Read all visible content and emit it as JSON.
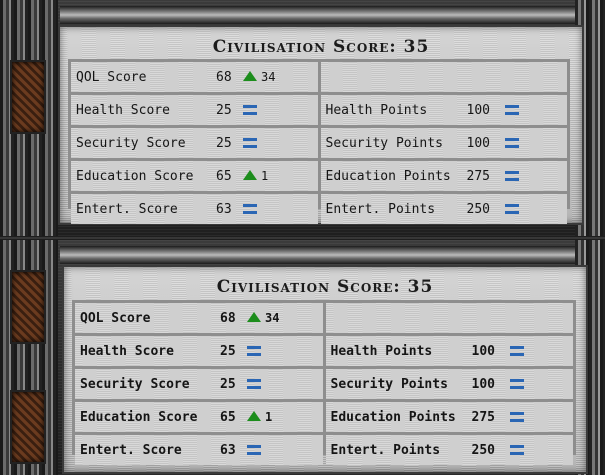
{
  "panels": [
    {
      "title": "Civilisation Score: 35",
      "rows": [
        {
          "left": {
            "label": "QOL Score",
            "value": "68",
            "indicator": "up-arrow-icon",
            "change": "34"
          },
          "right": null
        },
        {
          "left": {
            "label": "Health Score",
            "value": "25",
            "indicator": "equals-icon",
            "change": ""
          },
          "right": {
            "label": "Health Points",
            "value": "100",
            "indicator": "equals-icon"
          }
        },
        {
          "left": {
            "label": "Security Score",
            "value": "25",
            "indicator": "equals-icon",
            "change": ""
          },
          "right": {
            "label": "Security Points",
            "value": "100",
            "indicator": "equals-icon"
          }
        },
        {
          "left": {
            "label": "Education Score",
            "value": "65",
            "indicator": "up-arrow-icon",
            "change": "1"
          },
          "right": {
            "label": "Education Points",
            "value": "275",
            "indicator": "equals-icon"
          }
        },
        {
          "left": {
            "label": "Entert. Score",
            "value": "63",
            "indicator": "equals-icon",
            "change": ""
          },
          "right": {
            "label": "Entert. Points",
            "value": "250",
            "indicator": "equals-icon"
          }
        }
      ]
    },
    {
      "title": "Civilisation Score: 35",
      "rows": [
        {
          "left": {
            "label": "QOL Score",
            "value": "68",
            "indicator": "up-arrow-icon",
            "change": "34"
          },
          "right": null
        },
        {
          "left": {
            "label": "Health Score",
            "value": "25",
            "indicator": "equals-icon",
            "change": ""
          },
          "right": {
            "label": "Health Points",
            "value": "100",
            "indicator": "equals-icon"
          }
        },
        {
          "left": {
            "label": "Security Score",
            "value": "25",
            "indicator": "equals-icon",
            "change": ""
          },
          "right": {
            "label": "Security Points",
            "value": "100",
            "indicator": "equals-icon"
          }
        },
        {
          "left": {
            "label": "Education Score",
            "value": "65",
            "indicator": "up-arrow-icon",
            "change": "1"
          },
          "right": {
            "label": "Education Points",
            "value": "275",
            "indicator": "equals-icon"
          }
        },
        {
          "left": {
            "label": "Entert. Score",
            "value": "63",
            "indicator": "equals-icon",
            "change": ""
          },
          "right": {
            "label": "Entert. Points",
            "value": "250",
            "indicator": "equals-icon"
          }
        }
      ]
    }
  ],
  "colors": {
    "up_arrow": "#1c8d1c",
    "equals": "#2a66b4",
    "panel": "#c9c9c9"
  }
}
